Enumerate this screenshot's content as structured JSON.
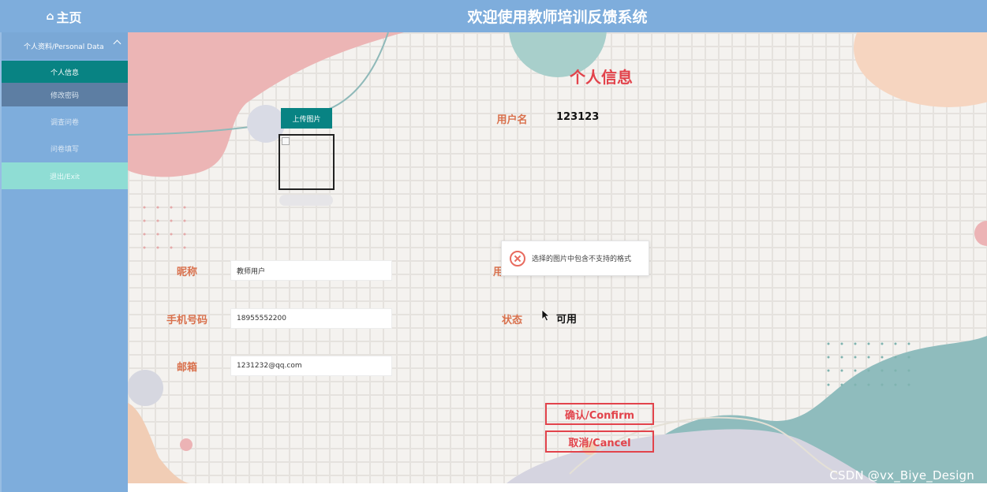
{
  "header": {
    "home_label": "主页",
    "home_icon": "home-icon",
    "title": "欢迎使用教师培训反馈系统"
  },
  "sidebar": {
    "group_label": "个人资料/Personal Data",
    "group_icon": "chevron-up-icon",
    "items": [
      {
        "label": "个人信息",
        "active": true
      },
      {
        "label": "修改密码"
      },
      {
        "label": "调查问卷"
      },
      {
        "label": "问卷填写"
      },
      {
        "label": "退出/Exit"
      }
    ]
  },
  "main": {
    "title": "个人信息",
    "upload_button": "上传图片",
    "fields": {
      "nickname": {
        "label": "昵称",
        "value": "教师用户"
      },
      "phone": {
        "label": "手机号码",
        "value": "18955552200"
      },
      "email": {
        "label": "邮箱",
        "value": "1231232@qq.com"
      }
    },
    "info": {
      "username": {
        "label": "用户名",
        "value": "123123"
      },
      "role": {
        "label": "用",
        "value": ""
      },
      "status": {
        "label": "状态",
        "value": "可用"
      }
    },
    "toast": {
      "message": "选择的图片中包含不支持的格式",
      "icon": "error-circle-icon"
    },
    "buttons": {
      "confirm": "确认/Confirm",
      "cancel": "取消/Cancel"
    }
  },
  "colors": {
    "topbar": "#7eaddc",
    "teal": "#088383",
    "accent": "#e2434b",
    "label": "#d9714d"
  },
  "watermark": "CSDN @vx_Biye_Design"
}
